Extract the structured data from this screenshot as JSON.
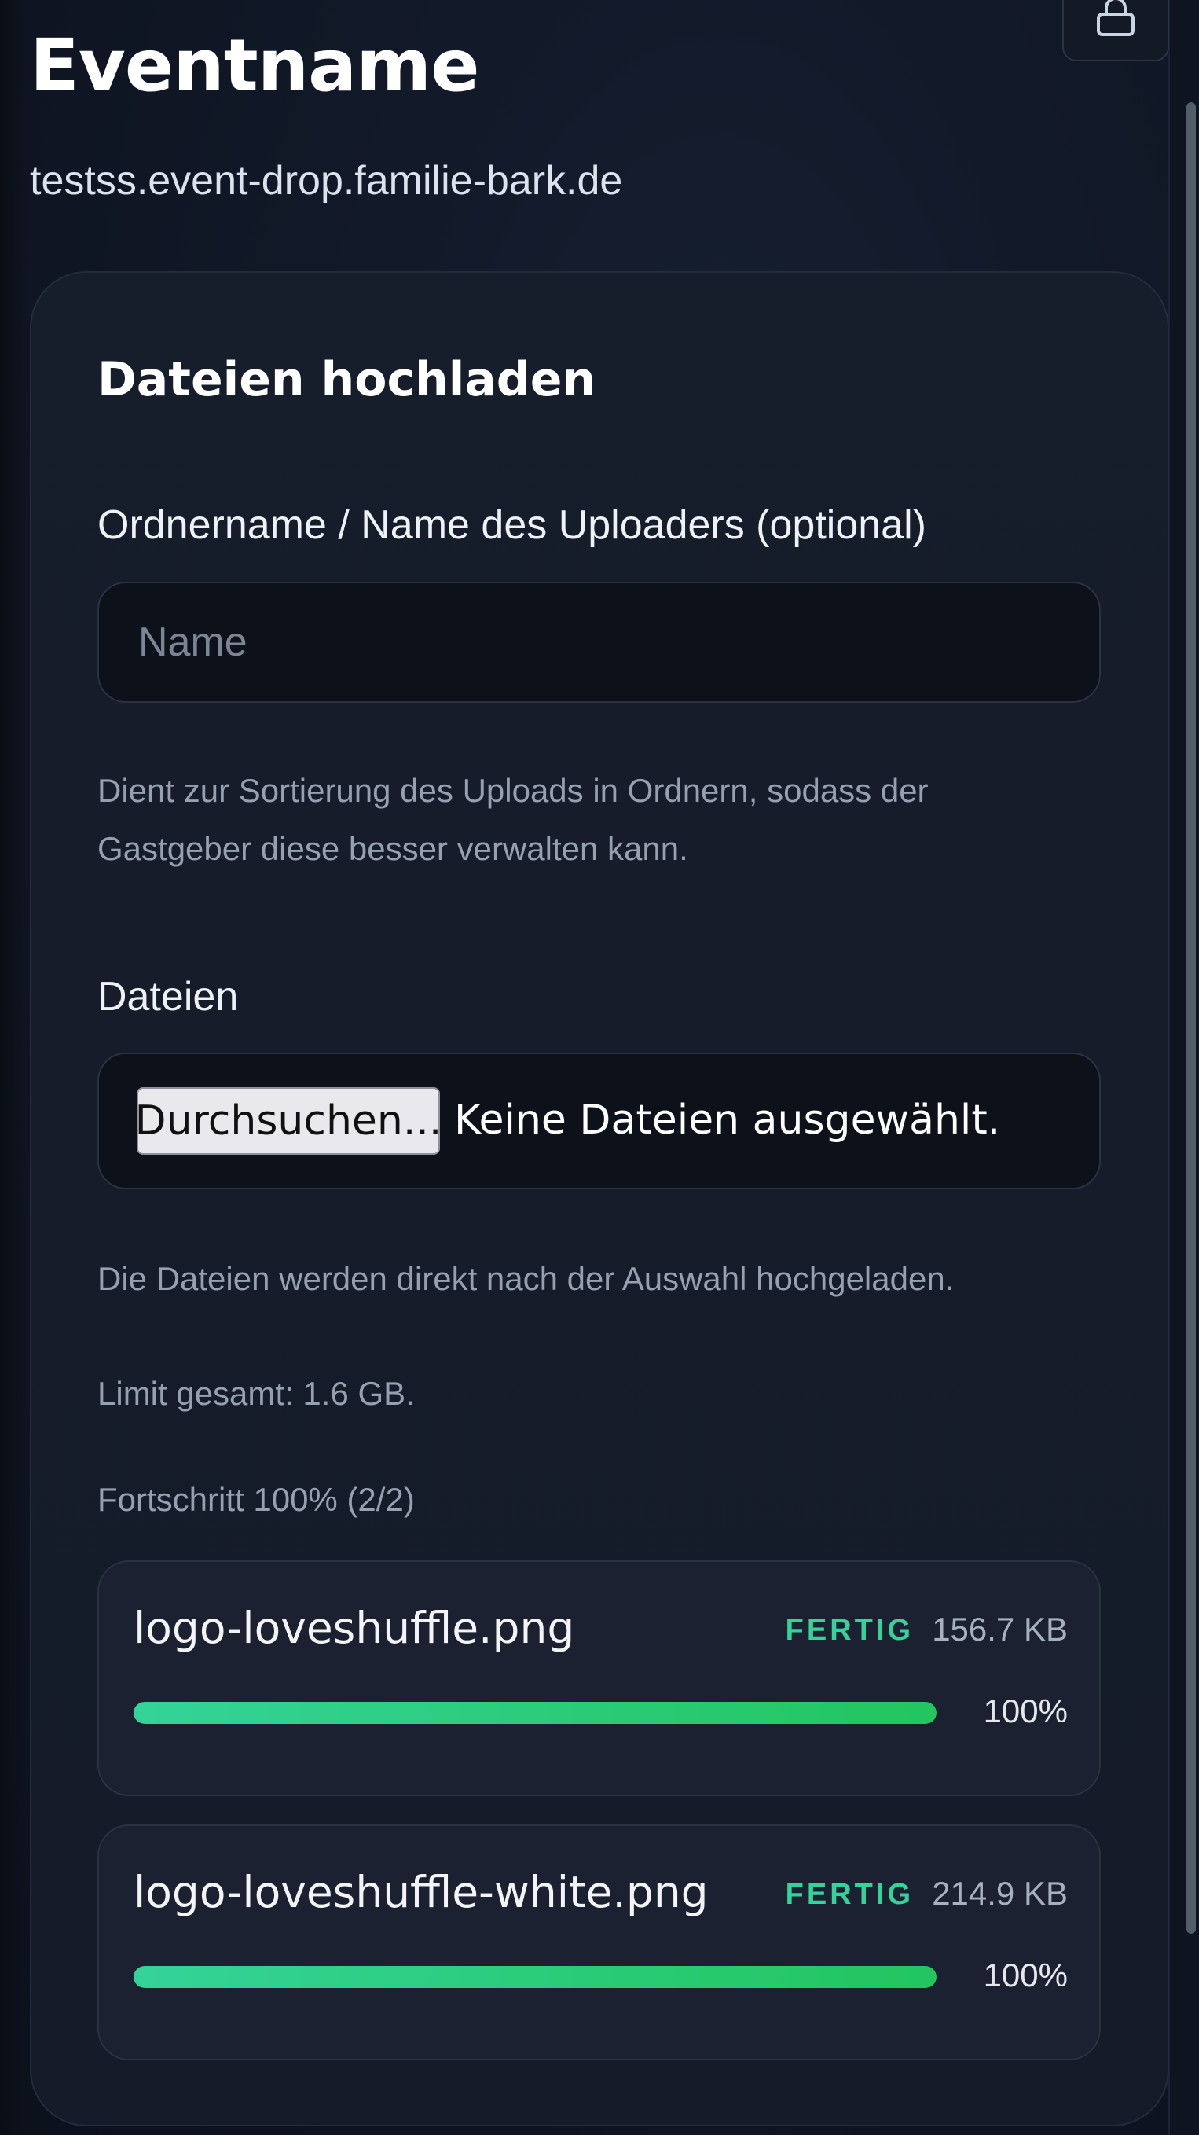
{
  "header": {
    "title": "Eventname",
    "domain": "testss.event-drop.familie-bark.de",
    "lock_icon": "lock-icon"
  },
  "upload": {
    "title": "Dateien hochladen",
    "folder_label": "Ordnername / Name des Uploaders (optional)",
    "folder_value": "",
    "folder_placeholder": "Name",
    "folder_help": "Dient zur Sortierung des Uploads in Ordnern, sodass der Gastgeber diese besser verwalten kann.",
    "files_label": "Dateien",
    "browse_button": "Durchsuchen...",
    "no_files_text": "Keine Dateien ausgewählt.",
    "auto_upload_help": "Die Dateien werden direkt nach der Auswahl hochgeladen.",
    "limit_text": "Limit gesamt: 1.6 GB.",
    "progress_text": "Fortschritt 100% (2/2)",
    "progress_percent": 100,
    "files": [
      {
        "name": "logo-loveshuffle.png",
        "status": "FERTIG",
        "size": "156.7 KB",
        "percent_label": "100%",
        "percent": 100
      },
      {
        "name": "logo-loveshuffle-white.png",
        "status": "FERTIG",
        "size": "214.9 KB",
        "percent_label": "100%",
        "percent": 100
      }
    ]
  },
  "colors": {
    "background": "#111827",
    "card": "#161d2b",
    "success": "#34d399",
    "progress_gradient_end": "#22c55e"
  }
}
